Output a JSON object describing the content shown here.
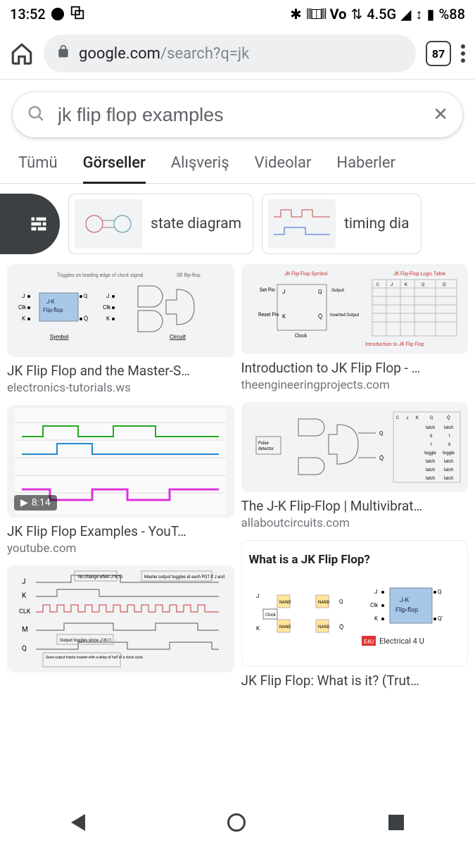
{
  "status": {
    "time": "13:52",
    "battery": "%88",
    "network": "4.5G",
    "volte": "Vo"
  },
  "browser": {
    "host": "google.com",
    "path": "/search?q=jk",
    "tab_count": "87"
  },
  "search": {
    "query": "jk flip flop examples"
  },
  "tabs": {
    "all": "Tümü",
    "images": "Görseller",
    "shopping": "Alışveriş",
    "videos": "Videolar",
    "news": "Haberler"
  },
  "chips": {
    "c0": "state diagram",
    "c1": "timing dia"
  },
  "results": {
    "r0": {
      "title": "JK Flip Flop and the Master-S…",
      "source": "electronics-tutorials.ws"
    },
    "r1": {
      "title": "Introduction to JK Flip Flop - …",
      "source": "theengineeringprojects.com"
    },
    "r2": {
      "title": "JK Flip Flop Examples - YouT…",
      "source": "youtube.com",
      "duration": "8:14"
    },
    "r3": {
      "title": "The J-K Flip-Flop | Multivibrat…",
      "source": "allaboutcircuits.com"
    },
    "r4": {
      "title": "",
      "source": ""
    },
    "r5": {
      "title": "JK Flip Flop: What is it? (Trut…",
      "source": ""
    },
    "whatis_heading": "What is a JK Flip Flop?",
    "e4u": "Electrical 4 U"
  }
}
